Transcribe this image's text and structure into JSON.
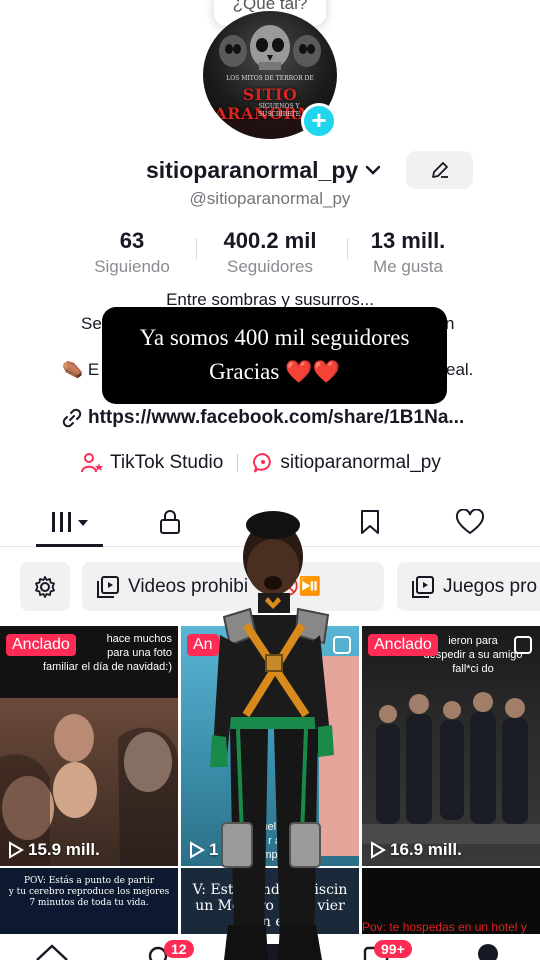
{
  "bubble": {
    "text": "¿Qué tal?"
  },
  "avatar": {
    "top_text": "LOS MITOS DE TERROR DE",
    "title": "SITIO PARANORMAL",
    "subtitle_1": "SÍGUENOS   Y",
    "subtitle_2": "SUSCRÍBETE"
  },
  "profile": {
    "username": "sitioparanormal_py",
    "handle": "@sitioparanormal_py"
  },
  "stats": [
    {
      "value": "63",
      "label": "Siguiendo"
    },
    {
      "value": "400.2 mil",
      "label": "Seguidores"
    },
    {
      "value": "13 mill.",
      "label": "Me gusta"
    }
  ],
  "bio": {
    "line1": "Entre sombras y susurros...",
    "line2_left": "Se",
    "line2_right": "n",
    "line3_left": "⚰️ E",
    "line3_right": "eal."
  },
  "caption": {
    "line1": "Ya somos 400 mil seguidores",
    "line2": "Gracias",
    "hearts": "❤️❤️"
  },
  "link": {
    "text": "https://www.facebook.com/share/1B1Na..."
  },
  "studio": {
    "left": "TikTok Studio",
    "right": "sitioparanormal_py"
  },
  "chips": [
    {
      "label": "Videos prohibi"
    },
    {
      "label": "Juegos pro"
    }
  ],
  "grid": {
    "tiles": [
      {
        "pin": "Anclado",
        "text": "hace muchos\npara una foto\nfamiliar el día de navidad:)",
        "views": "15.9 mill."
      },
      {
        "pin": "An",
        "text": "el e   uel   ació\nen l   r     ace\nempa",
        "views": "1"
      },
      {
        "pin": "Anclado",
        "text": "ieron para\ndespedir a su amigo\nfall*ci do",
        "views": "16.9 mill."
      },
      {
        "text": "POV: Estás a punto de partir\ny tu cerebro reproduce los mejores\n7 minutos de toda tu vida."
      },
      {
        "text": "V: Estás  ando  a piscin\nun Mot    ero el    do vier\nA     en el   a"
      },
      {
        "text": "Pov: te hospedas en un hotel y"
      }
    ]
  },
  "nav": {
    "badge_inbox": "12",
    "badge_messages": "99+"
  },
  "colors": {
    "accent": "#fe2c55",
    "plus": "#20d5ec",
    "text": "#161823",
    "muted": "#8a8b91"
  }
}
